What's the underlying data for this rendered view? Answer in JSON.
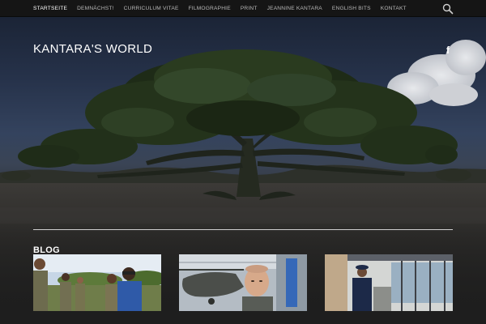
{
  "nav": {
    "items": [
      {
        "label": "STARTSEITE",
        "active": true
      },
      {
        "label": "DEMNÄCHST!",
        "active": false
      },
      {
        "label": "CURRICULUM VITAE",
        "active": false
      },
      {
        "label": "FILMOGRAPHIE",
        "active": false
      },
      {
        "label": "PRINT",
        "active": false
      },
      {
        "label": "JEANNINE KANTARA",
        "active": false
      },
      {
        "label": "ENGLISH BITS",
        "active": false
      },
      {
        "label": "KONTAKT",
        "active": false
      }
    ],
    "search_icon": "search-icon"
  },
  "hero": {
    "site_title": "KANTARA'S WORLD",
    "social_icon": "facebook-icon",
    "social_glyph": "f"
  },
  "blog": {
    "heading": "BLOG",
    "posts": [
      {
        "image": "group-photo-soldiers"
      },
      {
        "image": "helicopter-hangar-portrait"
      },
      {
        "image": "naval-officer-terminal"
      }
    ]
  },
  "colors": {
    "nav_bg": "#151515",
    "nav_text": "#b9b9b9",
    "nav_active": "#ffffff",
    "divider": "#cfcfcf"
  }
}
